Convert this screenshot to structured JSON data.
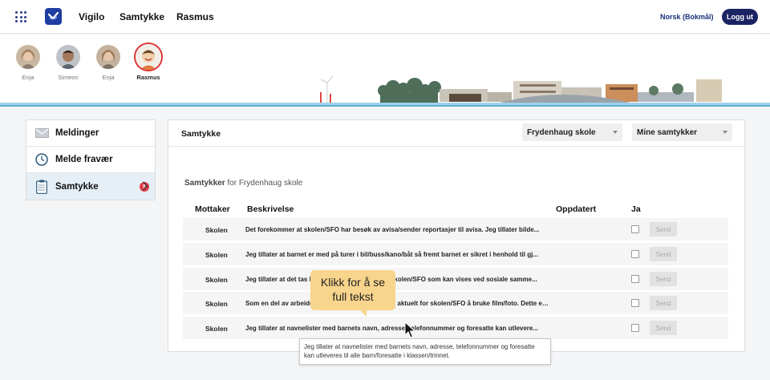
{
  "topbar": {
    "nav": [
      "Vigilo",
      "Samtykke",
      "Rasmus"
    ],
    "language": "Norsk (Bokmål)",
    "logout_label": "Logg ut"
  },
  "profiles": [
    {
      "name": "Enja",
      "selected": false
    },
    {
      "name": "Simeon",
      "selected": false
    },
    {
      "name": "Enja",
      "selected": false
    },
    {
      "name": "Rasmus",
      "selected": true
    }
  ],
  "sidebar": {
    "items": [
      {
        "label": "Meldinger",
        "icon": "mail-icon"
      },
      {
        "label": "Melde fravær",
        "icon": "clock-icon"
      },
      {
        "label": "Samtykke",
        "icon": "clipboard-icon",
        "badge": "5",
        "active": true
      }
    ]
  },
  "panel": {
    "title": "Samtykke",
    "school_select": "Frydenhaug skole",
    "filter_select": "Mine samtykker",
    "subtitle_bold": "Samtykker",
    "subtitle_rest": " for Frydenhaug skole"
  },
  "table": {
    "headers": {
      "to": "Mottaker",
      "desc": "Beskrivelse",
      "updated": "Oppdatert",
      "yes": "Ja"
    },
    "send_label": "Send",
    "rows": [
      {
        "to": "Skolen",
        "desc": "Det forekommer at skolen/SFO har besøk av avisa/sender reportasjer til avisa. Jeg tillater bilde..."
      },
      {
        "to": "Skolen",
        "desc": "Jeg tillater at barnet er med på turer i bil/buss/kano/båt så fremt barnet er sikret i henhold til gj..."
      },
      {
        "to": "Skolen",
        "desc": "Jeg tillater at det tas bilde/film fra aktiviteter på skolen/SFO som kan vises ved sosiale samme..."
      },
      {
        "to": "Skolen",
        "desc": "Som en del av arbeidet med skolen, kan det være aktuelt for skolen/SFO å bruke film/foto. Dette er til inter..."
      },
      {
        "to": "Skolen",
        "desc": "Jeg tillater at navnelister med barnets navn, adresse, telefonnummer og foresatte kan utlevere..."
      }
    ]
  },
  "callout": {
    "line1": "Klikk for å se",
    "line2": "full tekst"
  },
  "tooltip": {
    "text": "Jeg tillater at navnelister med barnets navn, adresse, telefonnummer og foresatte kan utleveres til alle barn/foresatte i klassen/trinnet."
  },
  "colors": {
    "brand": "#1b2462",
    "badge": "#e23b4a",
    "callout": "#f8d58c",
    "active_bg": "#e6eef6"
  }
}
